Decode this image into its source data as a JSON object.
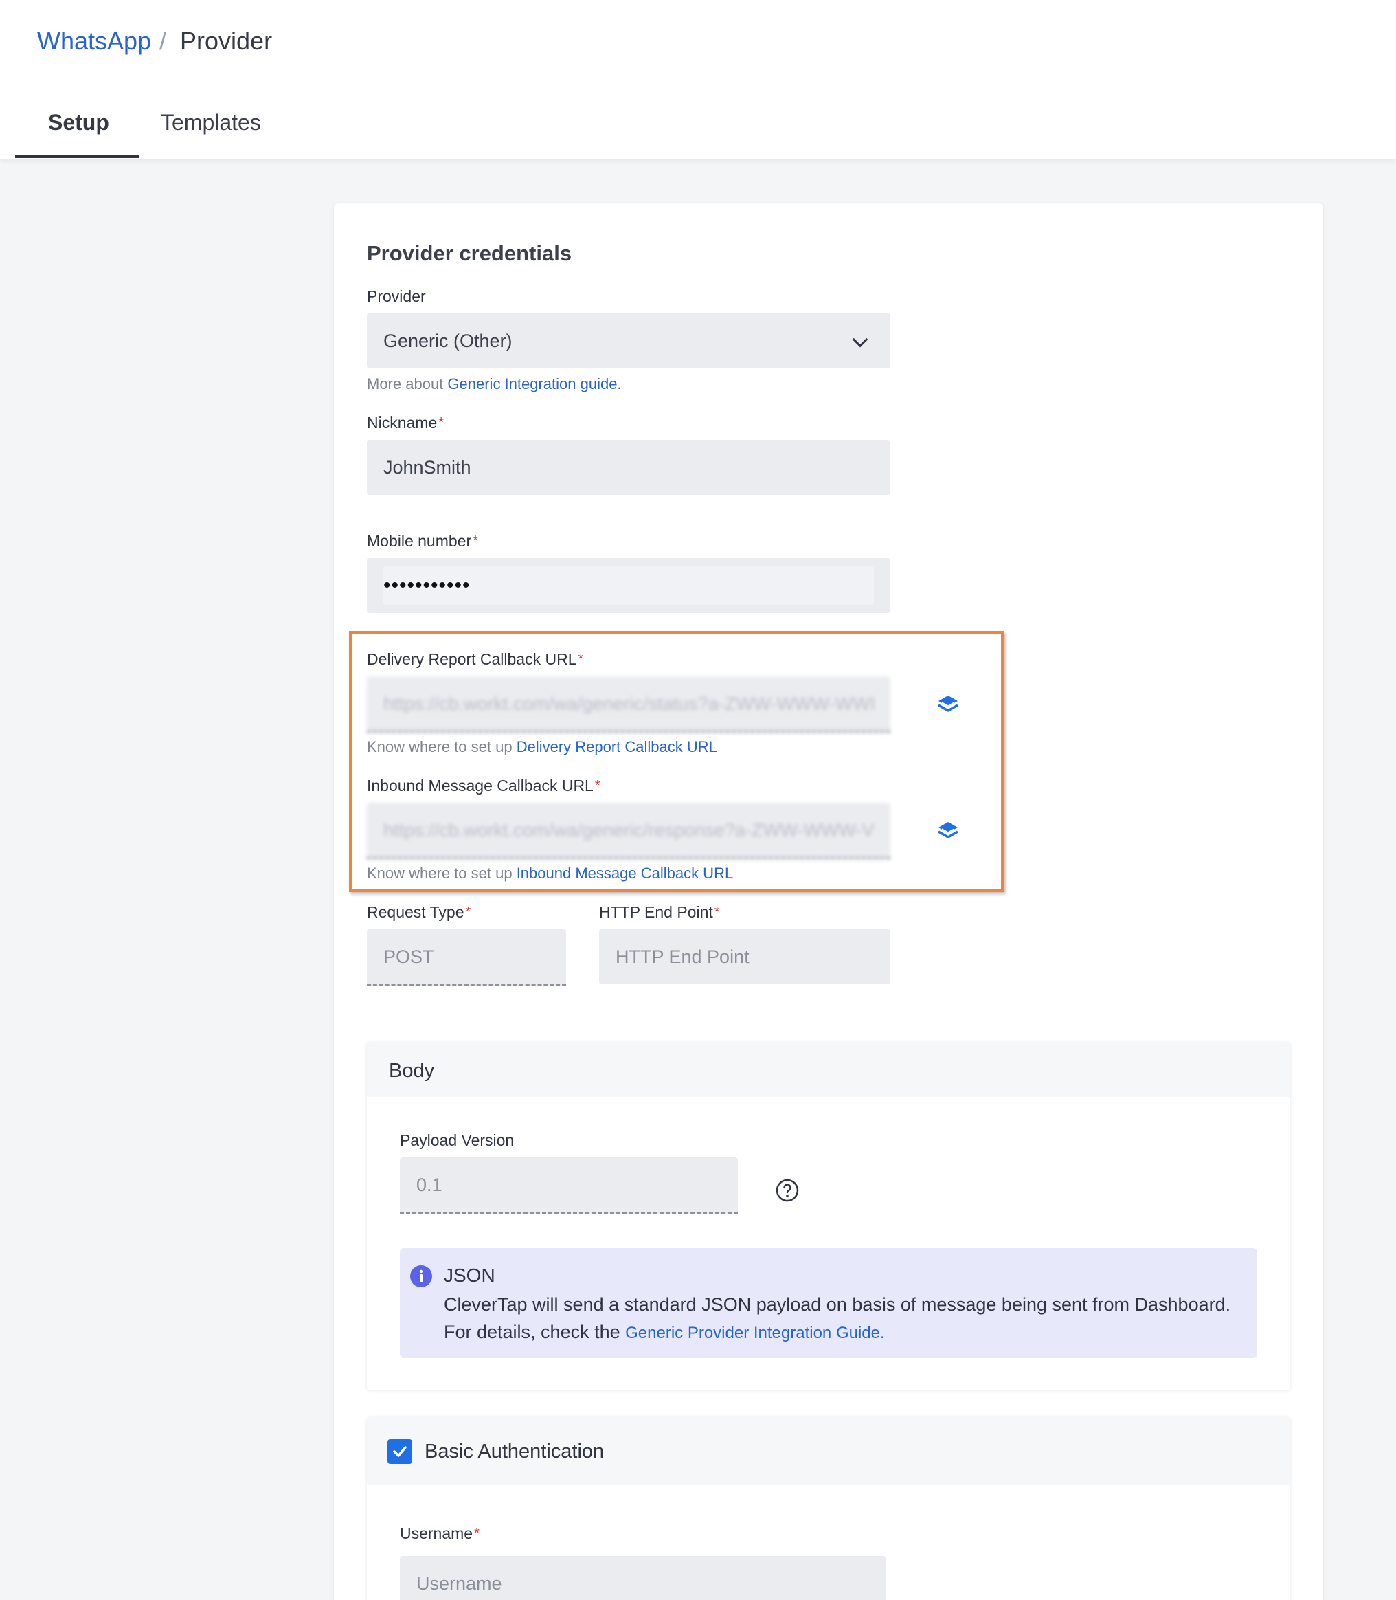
{
  "breadcrumb": {
    "parent": "WhatsApp",
    "separator": "/",
    "current": "Provider"
  },
  "tabs": [
    {
      "label": "Setup",
      "active": true
    },
    {
      "label": "Templates",
      "active": false
    }
  ],
  "credentials": {
    "title": "Provider credentials",
    "provider": {
      "label": "Provider",
      "value": "Generic (Other)",
      "help_prefix": "More about ",
      "help_link": "Generic Integration guide."
    },
    "nickname": {
      "label": "Nickname",
      "required": "*",
      "value": "JohnSmith"
    },
    "mobile": {
      "label": "Mobile number",
      "required": "*",
      "value": "•••••••••••"
    },
    "delivery_url": {
      "label": "Delivery Report Callback URL",
      "required": "*",
      "value": "https://cb.workt.com/wa/generic/status?a-ZWW-WWW-WWI",
      "help_prefix": "Know where to set up ",
      "help_link": "Delivery Report Callback URL"
    },
    "inbound_url": {
      "label": "Inbound Message Callback URL",
      "required": "*",
      "value": "https://cb.workt.com/wa/generic/response?a-ZWW-WWW-V",
      "help_prefix": "Know where to set up ",
      "help_link": "Inbound Message Callback URL"
    },
    "request_type": {
      "label": "Request Type",
      "required": "*",
      "value": "POST"
    },
    "http_endpoint": {
      "label": "HTTP End Point",
      "required": "*",
      "placeholder": "HTTP End Point"
    }
  },
  "body_panel": {
    "title": "Body",
    "payload_label": "Payload Version",
    "payload_value": "0.1",
    "info": {
      "title": "JSON",
      "line1": "CleverTap will send a standard JSON payload on basis of message being sent from Dashboard.",
      "line2_prefix": "For details, check the ",
      "line2_link": "Generic Provider Integration Guide."
    }
  },
  "auth_panel": {
    "title": "Basic Authentication",
    "checked": true,
    "username_label": "Username",
    "username_required": "*",
    "username_placeholder": "Username"
  },
  "colors": {
    "accent": "#2563d6",
    "highlight": "#f0843c",
    "required": "#e53935",
    "checkbox": "#1f6fe5"
  }
}
